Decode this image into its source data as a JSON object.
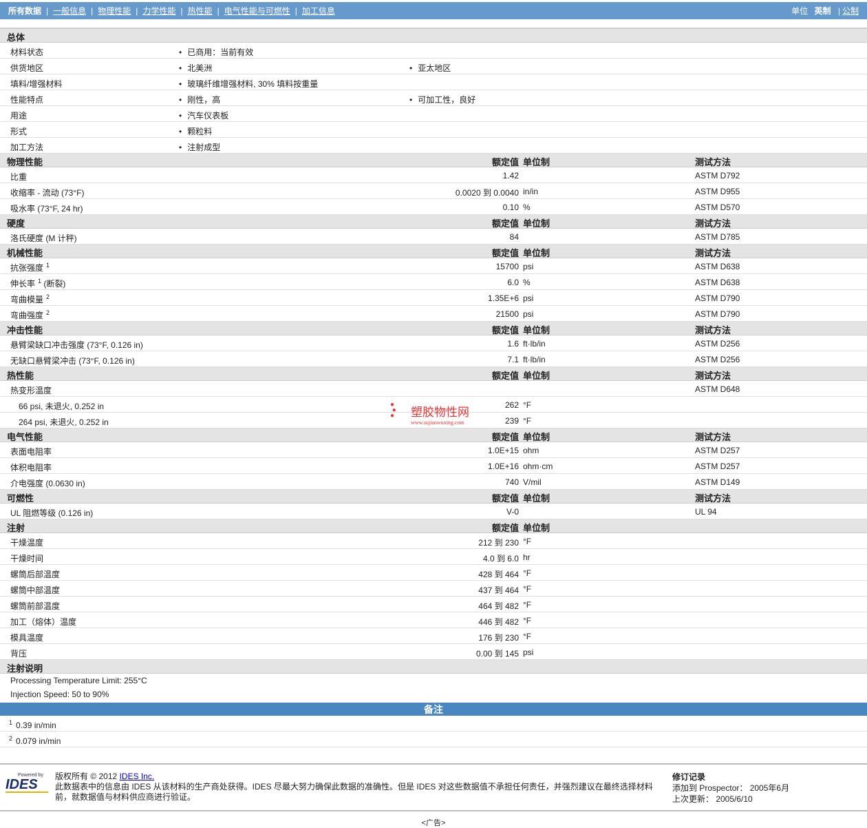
{
  "nav": {
    "items": [
      "所有数据",
      "一般信息",
      "物理性能",
      "力学性能",
      "热性能",
      "电气性能与可燃性",
      "加工信息"
    ],
    "unit_label": "单位",
    "unit_active": "英制",
    "unit_other": "公制"
  },
  "col_headers": {
    "value": "额定值",
    "unit": "单位制",
    "method": "测试方法"
  },
  "general": {
    "title": "总体",
    "rows": [
      {
        "name": "材料状态",
        "a": "已商用：当前有效",
        "b": ""
      },
      {
        "name": "供货地区",
        "a": "北美洲",
        "b": "亚太地区"
      },
      {
        "name": "填料/增强材料",
        "a": "玻璃纤维增强材料, 30% 填料按重量",
        "b": ""
      },
      {
        "name": "性能特点",
        "a": "刚性，高",
        "b": "可加工性，良好"
      },
      {
        "name": "用途",
        "a": "汽车仪表板",
        "b": ""
      },
      {
        "name": "形式",
        "a": "颗粒料",
        "b": ""
      },
      {
        "name": "加工方法",
        "a": "注射成型",
        "b": ""
      }
    ]
  },
  "sections": [
    {
      "title": "物理性能",
      "method": true,
      "rows": [
        {
          "name": "比重",
          "value": "1.42",
          "unit": "",
          "method": "ASTM D792"
        },
        {
          "name": "收缩率 - 流动 (73°F)",
          "value": "0.0020 到  0.0040",
          "unit": "in/in",
          "method": "ASTM D955"
        },
        {
          "name": "吸水率 (73°F, 24 hr)",
          "value": "0.10",
          "unit": "%",
          "method": "ASTM D570"
        }
      ]
    },
    {
      "title": "硬度",
      "method": true,
      "rows": [
        {
          "name": "洛氏硬度 (M 计秤)",
          "value": "84",
          "unit": "",
          "method": "ASTM D785"
        }
      ]
    },
    {
      "title": "机械性能",
      "method": true,
      "rows": [
        {
          "name": "抗张强度",
          "sup": "1",
          "value": "15700",
          "unit": "psi",
          "method": "ASTM D638"
        },
        {
          "name": "伸长率",
          "sup": "1",
          "suffix": " (断裂)",
          "value": "6.0",
          "unit": "%",
          "method": "ASTM D638"
        },
        {
          "name": "弯曲模量",
          "sup": "2",
          "value": "1.35E+6",
          "unit": "psi",
          "method": "ASTM D790"
        },
        {
          "name": "弯曲强度",
          "sup": "2",
          "value": "21500",
          "unit": "psi",
          "method": "ASTM D790"
        }
      ]
    },
    {
      "title": "冲击性能",
      "method": true,
      "rows": [
        {
          "name": "悬臂梁缺口冲击强度 (73°F, 0.126 in)",
          "value": "1.6",
          "unit": "ft·lb/in",
          "method": "ASTM D256"
        },
        {
          "name": "无缺口悬臂梁冲击 (73°F, 0.126 in)",
          "value": "7.1",
          "unit": "ft·lb/in",
          "method": "ASTM D256"
        }
      ]
    },
    {
      "title": "热性能",
      "method": true,
      "rows": [
        {
          "name": "热变形温度",
          "value": "",
          "unit": "",
          "method": "ASTM D648"
        },
        {
          "name": "66 psi, 未退火, 0.252 in",
          "indent": true,
          "value": "262",
          "unit": "°F",
          "method": ""
        },
        {
          "name": "264 psi, 未退火, 0.252 in",
          "indent": true,
          "value": "239",
          "unit": "°F",
          "method": ""
        }
      ]
    },
    {
      "title": "电气性能",
      "method": true,
      "rows": [
        {
          "name": "表面电阻率",
          "value": "1.0E+15",
          "unit": "ohm",
          "method": "ASTM D257"
        },
        {
          "name": "体积电阻率",
          "value": "1.0E+16",
          "unit": "ohm·cm",
          "method": "ASTM D257"
        },
        {
          "name": "介电强度 (0.0630 in)",
          "value": "740",
          "unit": "V/mil",
          "method": "ASTM D149"
        }
      ]
    },
    {
      "title": "可燃性",
      "method": true,
      "rows": [
        {
          "name": "UL 阻燃等级 (0.126 in)",
          "value": "V-0",
          "unit": "",
          "method": "UL 94"
        }
      ]
    },
    {
      "title": "注射",
      "method": false,
      "rows": [
        {
          "name": "干燥温度",
          "value": "212 到  230",
          "unit": "°F",
          "method": ""
        },
        {
          "name": "干燥时间",
          "value": "4.0 到  6.0",
          "unit": "hr",
          "method": ""
        },
        {
          "name": "螺筒后部温度",
          "value": "428 到  464",
          "unit": "°F",
          "method": ""
        },
        {
          "name": "螺筒中部温度",
          "value": "437 到  464",
          "unit": "°F",
          "method": ""
        },
        {
          "name": "螺筒前部温度",
          "value": "464 到  482",
          "unit": "°F",
          "method": ""
        },
        {
          "name": "加工（熔体）温度",
          "value": "446 到  482",
          "unit": "°F",
          "method": ""
        },
        {
          "name": "模具温度",
          "value": "176 到  230",
          "unit": "°F",
          "method": ""
        },
        {
          "name": "背压",
          "value": "0.00 到  145",
          "unit": "psi",
          "method": ""
        }
      ]
    }
  ],
  "injection_notes": {
    "title": "注射说明",
    "lines": [
      "Processing Temperature Limit: 255°C",
      "Injection Speed: 50 to 90%"
    ]
  },
  "notes": {
    "title": "备注",
    "items": [
      {
        "sup": "1",
        "text": "0.39 in/min"
      },
      {
        "sup": "2",
        "text": "0.079 in/min"
      }
    ]
  },
  "watermark": {
    "name": "塑胶物性网",
    "url": "www.sujiaowuxing.com"
  },
  "footer": {
    "logo_small": "Powered by",
    "logo": "IDES",
    "copyright": "版权所有  © 2012",
    "company": "IDES Inc.",
    "disclaimer": "此数据表中的信息由 IDES 从该材料的生产商处获得。IDES 尽最大努力确保此数据的准确性。但是 IDES 对这些数据值不承担任何责任，并强烈建议在最终选择材料前，就数据值与材料供应商进行验证。",
    "rev_title": "修订记录",
    "added": "添加到 Prospector： 2005年6月",
    "updated": "上次更新： 2005/6/10"
  },
  "ad": "<广告>"
}
